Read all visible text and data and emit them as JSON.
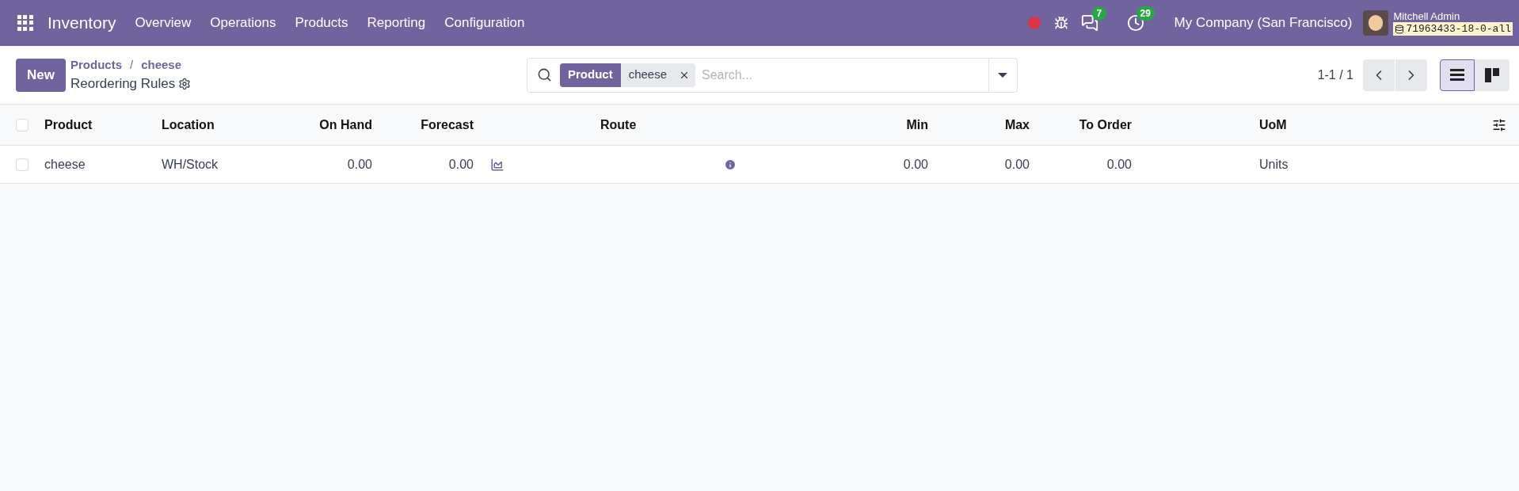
{
  "navbar": {
    "app_name": "Inventory",
    "menu": [
      "Overview",
      "Operations",
      "Products",
      "Reporting",
      "Configuration"
    ],
    "messages_count": "7",
    "activities_count": "29",
    "company": "My Company (San Francisco)",
    "user_name": "Mitchell Admin",
    "database": "71963433-18-0-all"
  },
  "control_panel": {
    "new_button": "New",
    "breadcrumb": [
      "Products",
      "cheese"
    ],
    "breadcrumb_separator": "/",
    "title": "Reordering Rules",
    "search": {
      "facet_label": "Product",
      "facet_value": "cheese",
      "placeholder": "Search..."
    },
    "pager": "1-1 / 1",
    "views": [
      {
        "kind": "list",
        "selected": true
      },
      {
        "kind": "kanban",
        "selected": false
      }
    ]
  },
  "table": {
    "all_checked": false,
    "columns": [
      "Product",
      "Location",
      "On Hand",
      "Forecast",
      "Route",
      "Min",
      "Max",
      "To Order",
      "UoM"
    ],
    "rows": [
      {
        "checked": false,
        "product": "cheese",
        "location": "WH/Stock",
        "on_hand": "0.00",
        "forecast": "0.00",
        "min": "0.00",
        "max": "0.00",
        "to_order": "0.00",
        "uom": "Units"
      }
    ]
  }
}
